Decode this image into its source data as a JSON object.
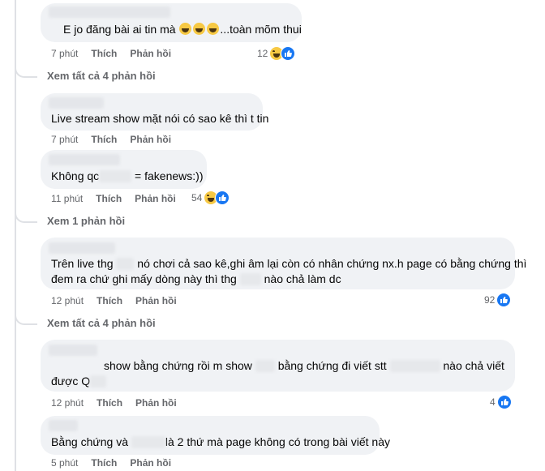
{
  "comments": [
    {
      "text_parts": [
        "E jo đăng bài ai tin mà ",
        "...toàn mõm thui"
      ],
      "time": "7 phút",
      "like": "Thích",
      "reply": "Phản hồi",
      "reaction_count": "12",
      "reaction_icons": [
        "haha-icon",
        "like-icon"
      ]
    },
    {
      "text_parts": [
        "Live stream show mặt nói có sao kê thì t tin"
      ],
      "time": "7 phút",
      "like": "Thích",
      "reply": "Phản hồi"
    },
    {
      "text_parts": [
        "Không qc",
        " = fakenews:))"
      ],
      "time": "11 phút",
      "like": "Thích",
      "reply": "Phản hồi",
      "reaction_count": "54",
      "reaction_icons": [
        "haha-icon",
        "like-icon"
      ]
    },
    {
      "line1_parts": [
        "Trên live thg ",
        " nó chơi cả sao kê,ghi âm lại còn có nhân chứng nx.h page có bằng chứng thì"
      ],
      "line2_parts": [
        "đem ra chứ ghi mấy dòng này thì thg ",
        " nào chả làm dc"
      ],
      "time": "12 phút",
      "like": "Thích",
      "reply": "Phản hồi",
      "reaction_count": "92",
      "reaction_icons": [
        "like-icon"
      ]
    },
    {
      "line1_parts": [
        "show bằng chứng rồi m show ",
        " bằng chứng đi viết stt ",
        " nào chả viết"
      ],
      "line2_parts": [
        "được Q"
      ],
      "time": "12 phút",
      "like": "Thích",
      "reply": "Phản hồi",
      "reaction_count": "4",
      "reaction_icons": [
        "like-icon"
      ]
    },
    {
      "text_parts": [
        "Bằng chứng và ",
        "là 2 thứ mà page không có trong bài viết này"
      ],
      "time": "5 phút",
      "like": "Thích",
      "reply": "Phản hồi"
    }
  ],
  "view_more": [
    "Xem tất cả 4 phản hồi",
    "Xem 1 phản hồi",
    "Xem tất cả 4 phản hồi"
  ],
  "colors": {
    "bubble": "#f0f2f5",
    "meta_text": "#65676b",
    "like_blue": "#1877f2",
    "haha_yellow": "#f7c944"
  }
}
